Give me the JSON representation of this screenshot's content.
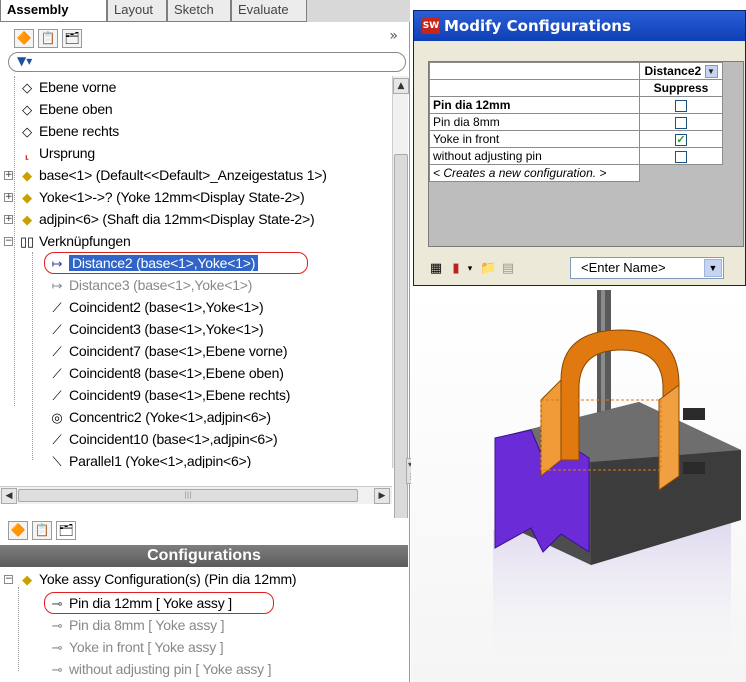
{
  "tabs": [
    "Assembly",
    "Layout",
    "Sketch",
    "Evaluate"
  ],
  "tree": [
    {
      "label": "Ebene vorne",
      "icon": "plane-icon"
    },
    {
      "label": "Ebene oben",
      "icon": "plane-icon"
    },
    {
      "label": "Ebene rechts",
      "icon": "plane-icon"
    },
    {
      "label": "Ursprung",
      "icon": "origin-icon"
    },
    {
      "label": "base<1> (Default<<Default>_Anzeigestatus 1>)",
      "icon": "part-icon"
    },
    {
      "label": "Yoke<1>->? (Yoke 12mm<Display State-2>)",
      "icon": "part-icon"
    },
    {
      "label": "adjpin<6> (Shaft dia 12mm<Display State-2>)",
      "icon": "part-icon"
    },
    {
      "label": "Verknüpfungen",
      "icon": "mates-folder-icon"
    },
    {
      "label": "Distance2 (base<1>,Yoke<1>)",
      "icon": "distance-mate-icon"
    },
    {
      "label": "Distance3 (base<1>,Yoke<1>)",
      "icon": "distance-mate-icon"
    },
    {
      "label": "Coincident2 (base<1>,Yoke<1>)",
      "icon": "coincident-mate-icon"
    },
    {
      "label": "Coincident3 (base<1>,Yoke<1>)",
      "icon": "coincident-mate-icon"
    },
    {
      "label": "Coincident7 (base<1>,Ebene vorne)",
      "icon": "coincident-mate-icon"
    },
    {
      "label": "Coincident8 (base<1>,Ebene oben)",
      "icon": "coincident-mate-icon"
    },
    {
      "label": "Coincident9 (base<1>,Ebene rechts)",
      "icon": "coincident-mate-icon"
    },
    {
      "label": "Concentric2 (Yoke<1>,adjpin<6>)",
      "icon": "concentric-mate-icon"
    },
    {
      "label": "Coincident10 (base<1>,adjpin<6>)",
      "icon": "coincident-mate-icon"
    },
    {
      "label": "Parallel1 (Yoke<1>,adjpin<6>)",
      "icon": "parallel-mate-icon"
    }
  ],
  "configurations": {
    "header": "Configurations",
    "root": "Yoke assy Configuration(s)  (Pin dia 12mm)",
    "items": [
      "Pin dia 12mm [ Yoke assy ]",
      "Pin dia 8mm [ Yoke assy ]",
      "Yoke in front [ Yoke assy ]",
      "without adjusting pin [ Yoke assy ]"
    ]
  },
  "dialog": {
    "title": "Modify Configurations",
    "column_dimension": "Distance2",
    "column_param": "Suppress",
    "rows": [
      {
        "name": "Pin dia 12mm",
        "checked": false,
        "bold": true
      },
      {
        "name": "Pin dia 8mm",
        "checked": false,
        "bold": false
      },
      {
        "name": "Yoke in front",
        "checked": true,
        "bold": false
      },
      {
        "name": "without adjusting pin",
        "checked": false,
        "bold": false
      }
    ],
    "new_config": "< Creates a new configuration. >",
    "name_combo": "<Enter Name>"
  },
  "colors": {
    "yoke": "#e07a10",
    "base_face": "#6b2bd6",
    "base_body": "#4a4a4a",
    "title_bar": "#1a4cc8",
    "highlight": "#e02020"
  }
}
